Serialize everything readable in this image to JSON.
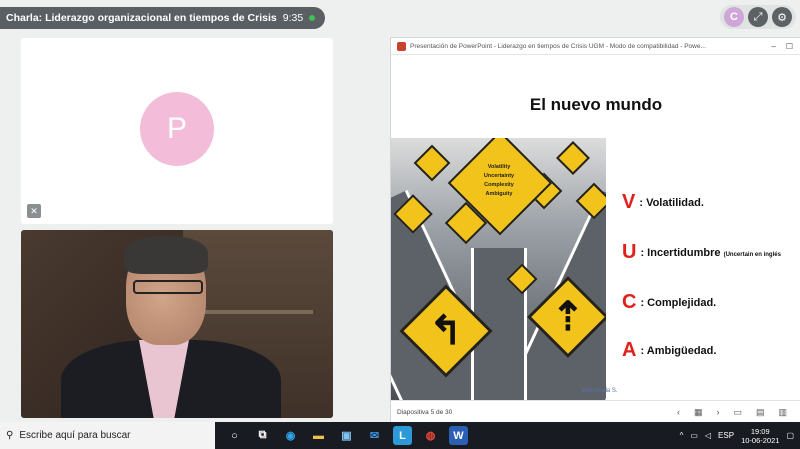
{
  "meeting": {
    "title": "Charla: Liderazgo organizacional en tiempos de Crisis",
    "time": "9:35"
  },
  "controls": {
    "avatar_initial": "C"
  },
  "participant": {
    "initial": "P"
  },
  "powerpoint": {
    "window_title": "Presentación de PowerPoint - Liderazgo en tiempos de Crisis UGM - Modo de compatibilidad - Powe...",
    "slide_status": "Diapositiva 5 de 30"
  },
  "slide": {
    "title": "El nuevo mundo",
    "sign_words": [
      "Volatility",
      "Uncertainty",
      "Complexity",
      "Ambiguity"
    ],
    "items": [
      {
        "letter": "V",
        "text": ": Volatilidad.",
        "note": ""
      },
      {
        "letter": "U",
        "text": ": Incertidumbre",
        "note": "(Uncertain en inglés"
      },
      {
        "letter": "C",
        "text": ": Complejidad.",
        "note": ""
      },
      {
        "letter": "A",
        "text": ": Ambigüedad.",
        "note": ""
      }
    ],
    "credit": "Valenzuela S."
  },
  "taskbar": {
    "search_placeholder": "Escribe aquí para buscar",
    "language": "ESP",
    "time": "19:09",
    "date": "10-06-2021"
  },
  "colors": {
    "accent_red": "#e0201a",
    "sign_yellow": "#f2c31a"
  }
}
